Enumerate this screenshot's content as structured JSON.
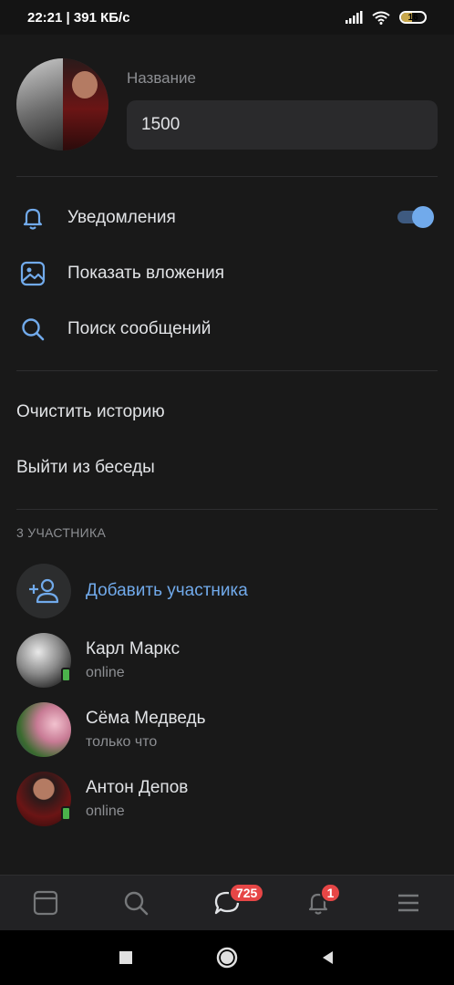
{
  "status_bar": {
    "time_speed": "22:21 | 391 КБ/с",
    "battery": "16"
  },
  "chat": {
    "name_label": "Название",
    "name_value": "1500"
  },
  "options": [
    {
      "label": "Уведомления",
      "icon": "bell-icon"
    },
    {
      "label": "Показать вложения",
      "icon": "image-icon"
    },
    {
      "label": "Поиск сообщений",
      "icon": "search-icon"
    }
  ],
  "notifications_enabled": true,
  "actions": {
    "clear_history": "Очистить историю",
    "leave_chat": "Выйти из беседы"
  },
  "members_section": {
    "title": "3 УЧАСТНИКА",
    "add_member": "Добавить участника",
    "members": [
      {
        "name": "Карл Маркс",
        "status": "online",
        "online": true
      },
      {
        "name": "Сёма Медведь",
        "status": "только что",
        "online": false
      },
      {
        "name": "Антон Депов",
        "status": "online",
        "online": true
      }
    ]
  },
  "tabbar": {
    "messages_badge": "725",
    "notifications_badge": "1"
  },
  "colors": {
    "accent": "#71aaeb",
    "background": "#191919",
    "badge": "#e64646",
    "online": "#4bb34b"
  }
}
